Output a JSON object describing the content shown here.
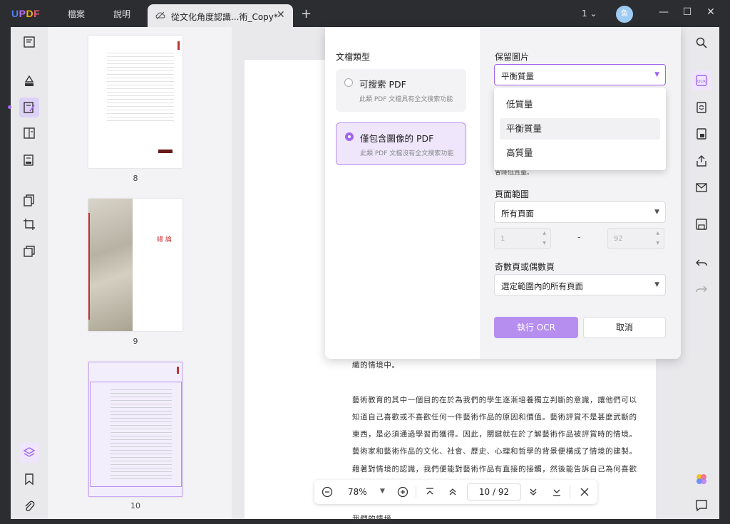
{
  "app": {
    "logo": "UPDF"
  },
  "menu": {
    "file": "檔案",
    "help": "說明"
  },
  "tab": {
    "title": "從文化角度認識...術_Copy*",
    "close": "✕",
    "add": "+"
  },
  "window": {
    "page_count": "1",
    "avatar": "鱼"
  },
  "thumbnails": [
    {
      "page": "8"
    },
    {
      "page": "9",
      "heading": "總 論"
    },
    {
      "page": "10"
    }
  ],
  "ocr": {
    "doc_type_label": "文檔類型",
    "option_searchable": {
      "title": "可搜索 PDF",
      "desc": "此類 PDF 文檔具有全文搜索功能"
    },
    "option_image_only": {
      "title": "僅包含圖像的 PDF",
      "desc": "此類 PDF 文檔沒有全文搜索功能"
    },
    "image_keep_label": "保留圖片",
    "image_keep_value": "平衡質量",
    "quality_options": [
      "低質量",
      "平衡質量",
      "高質量"
    ],
    "hidden_text": "會降低質量。",
    "page_range_label": "頁面範圍",
    "page_range_value": "所有頁面",
    "range_from": "1",
    "range_to": "92",
    "range_sep": "-",
    "odd_even_label": "奇數頁或偶數頁",
    "odd_even_value": "選定範圍內的所有頁面",
    "run_button": "執行 OCR",
    "cancel_button": "取消"
  },
  "document": {
    "lines": [
      "織的情境中。",
      "藝術教育的其中一個目的在於為我們的學生逐漸培養獨立判斷的意識，讓他們可以",
      "知道自己喜歡或不喜歡任何一件藝術作品的原因和價值。藝術評賞不是甚麼武斷的",
      "東西，是必須通過學習而獲得。因此，關鍵就在於了解藝術作品被評賞時的情境。",
      "藝術家和藝術作品的文化、社會、歷史、心理和哲學的背景便構成了情境的建製。",
      "藉著對情境的認識，我們便能對藝術作品有直接的接觸，然後能告訴自己為何喜歡",
      "我們的情境。"
    ]
  },
  "zoom": {
    "value": "78%",
    "current_page": "10",
    "total_pages": "92",
    "sep": "/"
  },
  "colors": {
    "accent": "#a066f0",
    "accent_light": "#b68ef0",
    "titlebar": "#2c2d30"
  }
}
